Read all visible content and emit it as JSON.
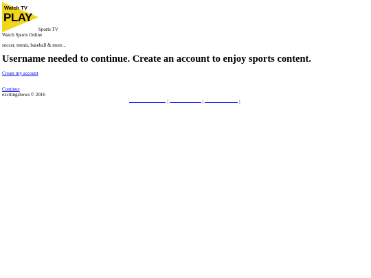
{
  "header": {
    "logo": {
      "line1": "Watch TV",
      "line2": "PLAY",
      "colors": {
        "background": "#f2d61b",
        "text": "#000000",
        "arrow": "#f2d61b"
      }
    },
    "site_name": "Sports TV",
    "tagline": "Watch Sports Online"
  },
  "main": {
    "sports_list": "soccer, tennis, baseball & more...",
    "heading": "Username needed to continue. Create an account to enjoy sports content.",
    "create_account_link": "Create my account",
    "continue_link": "Continue"
  },
  "footer": {
    "copyright": "excitingshows © 2016",
    "separator": "|",
    "link_color": "#0000ee"
  }
}
